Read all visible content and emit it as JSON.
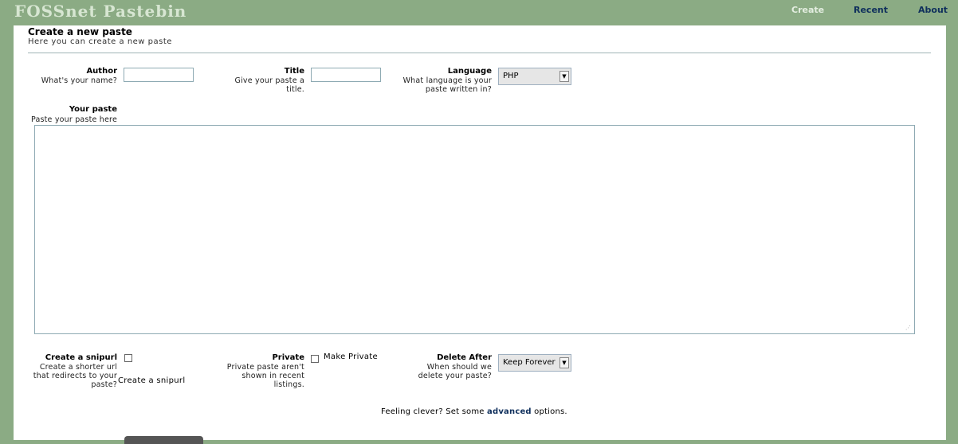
{
  "header": {
    "logo": "FOSSnet Pastebin",
    "nav": {
      "create": "Create",
      "recent": "Recent",
      "about": "About"
    }
  },
  "page": {
    "title": "Create a new paste",
    "subtitle": "Here you can create a new paste"
  },
  "form": {
    "author": {
      "label": "Author",
      "hint": "What's your name?",
      "value": ""
    },
    "title": {
      "label": "Title",
      "hint_line1": "Give your paste a",
      "hint_line2": "title.",
      "value": ""
    },
    "language": {
      "label": "Language",
      "hint_line1": "What language is your",
      "hint_line2": "paste written in?",
      "selected": "PHP"
    },
    "paste": {
      "label": "Your paste",
      "hint": "Paste your paste here",
      "value": ""
    },
    "snipurl": {
      "label": "Create a snipurl",
      "hint_line1": "Create a shorter url",
      "hint_line2": "that redirects to your",
      "hint_line3": "paste?",
      "checkbox_label": "Create a snipurl",
      "checked": false
    },
    "private": {
      "label": "Private",
      "hint_line1": "Private paste aren't",
      "hint_line2": "shown in recent",
      "hint_line3": "listings.",
      "checkbox_label": "Make Private",
      "checked": false
    },
    "delete_after": {
      "label": "Delete After",
      "hint_line1": "When should we",
      "hint_line2": "delete your paste?",
      "selected": "Keep Forever"
    },
    "advanced": {
      "prefix": "Feeling clever? Set some ",
      "link": "advanced",
      "suffix": " options."
    }
  },
  "icons": {
    "dropdown": "dropdown-arrow-icon",
    "resize": "resize-grip-icon"
  }
}
